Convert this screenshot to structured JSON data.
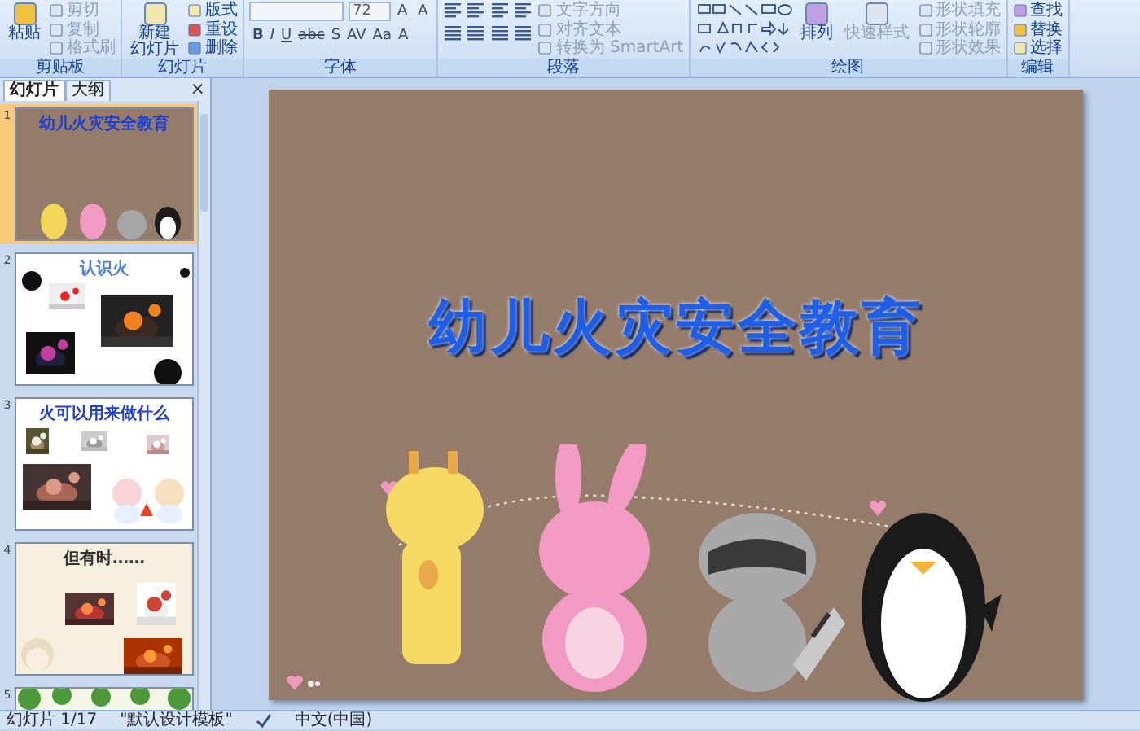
{
  "ribbon": {
    "groups": [
      {
        "label": "剪贴板",
        "items": [
          {
            "kind": "large",
            "lines": [
              "粘贴"
            ],
            "disabled": false
          },
          {
            "kind": "stack",
            "entries": [
              {
                "label": "剪切",
                "disabled": true
              },
              {
                "label": "复制",
                "disabled": true
              },
              {
                "label": "格式刷",
                "disabled": true
              }
            ]
          }
        ]
      },
      {
        "label": "幻灯片",
        "items": [
          {
            "kind": "large",
            "lines": [
              "新建",
              "幻灯片"
            ],
            "disabled": false
          },
          {
            "kind": "stack",
            "entries": [
              {
                "label": "版式",
                "disabled": false
              },
              {
                "label": "重设",
                "disabled": false
              },
              {
                "label": "删除",
                "disabled": false
              }
            ]
          }
        ]
      },
      {
        "label": "字体",
        "items": [
          {
            "kind": "font",
            "size": "72",
            "top_glyphs": [
              "A",
              "A"
            ],
            "bottom_glyphs": [
              "B",
              "I",
              "U",
              "abc",
              "S",
              "AV",
              "Aa",
              "A"
            ]
          }
        ]
      },
      {
        "label": "段落",
        "items": [
          {
            "kind": "paragraph"
          },
          {
            "kind": "stack",
            "entries": [
              {
                "label": "文字方向",
                "disabled": true
              },
              {
                "label": "对齐文本",
                "disabled": true
              },
              {
                "label": "转换为 SmartArt",
                "disabled": true
              }
            ]
          }
        ]
      },
      {
        "label": "绘图",
        "items": [
          {
            "kind": "shapes"
          },
          {
            "kind": "large",
            "lines": [
              "排列"
            ],
            "disabled": false
          },
          {
            "kind": "large",
            "lines": [
              "快速样式"
            ],
            "disabled": true
          },
          {
            "kind": "stack",
            "entries": [
              {
                "label": "形状填充",
                "disabled": true
              },
              {
                "label": "形状轮廓",
                "disabled": true
              },
              {
                "label": "形状效果",
                "disabled": true
              }
            ]
          }
        ]
      },
      {
        "label": "编辑",
        "items": [
          {
            "kind": "stack",
            "entries": [
              {
                "label": "查找",
                "disabled": false
              },
              {
                "label": "替换",
                "disabled": false
              },
              {
                "label": "选择",
                "disabled": false
              }
            ]
          }
        ]
      }
    ]
  },
  "pane": {
    "tabs": [
      {
        "label": "幻灯片",
        "selected": true
      },
      {
        "label": "大纲",
        "selected": false
      }
    ],
    "close": "×",
    "slides": [
      {
        "number": "1",
        "selected": true,
        "kind": "title",
        "title": "幼儿火灾安全教育"
      },
      {
        "number": "2",
        "selected": false,
        "kind": "dots",
        "title": "认识火"
      },
      {
        "number": "3",
        "selected": false,
        "kind": "plain",
        "title": "火可以用来做什么"
      },
      {
        "number": "4",
        "selected": false,
        "kind": "beige",
        "title": "但有时……"
      },
      {
        "number": "5",
        "selected": false,
        "kind": "leaves"
      }
    ]
  },
  "slide": {
    "title": "幼儿火灾安全教育"
  },
  "status_bar": {
    "slide": "幻灯片 1/17",
    "theme": "\"默认设计模板\"",
    "language": "中文(中国)"
  }
}
